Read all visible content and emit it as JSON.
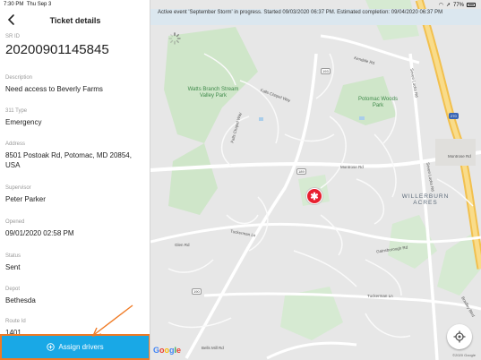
{
  "status_bar": {
    "time": "7:30 PM",
    "day": "Thu Sep 3",
    "battery": "77%"
  },
  "panel": {
    "title": "Ticket details",
    "fields": [
      {
        "label": "SR ID",
        "value": "20200901145845"
      },
      {
        "label": "Description",
        "value": "Need access to Beverly Farms"
      },
      {
        "label": "311 Type",
        "value": "Emergency"
      },
      {
        "label": "Address",
        "value": "8501 Postoak Rd, Potomac, MD 20854, USA"
      },
      {
        "label": "Supervisor",
        "value": "Peter  Parker"
      },
      {
        "label": "Opened",
        "value": "09/01/2020 02:58 PM"
      },
      {
        "label": "Status",
        "value": "Sent"
      },
      {
        "label": "Depot",
        "value": "Bethesda"
      },
      {
        "label": "Route Id",
        "value": "1401"
      }
    ],
    "assign_button": "Assign drivers"
  },
  "banner": "Active event 'September Storm' in progress. Started 09/03/2020 06:37 PM. Estimated completion: 09/04/2020 06:37 PM",
  "map": {
    "parks": [
      "Watts Branch Stream Valley Park",
      "Potomac Woods Park"
    ],
    "area_label": "WILLERBURN ACRES",
    "roads": [
      "Falls Chapel Way",
      "Falls Chapel Way",
      "Montrose Rd",
      "Montrose Rd",
      "Seven Locks Rd",
      "Seven Locks Rd",
      "Tuckerman Ln",
      "Tuckerman Ln",
      "Gainsborough Rd",
      "Glen Rd",
      "Bells Mill Rd",
      "Kendale Rd",
      "Bradley Blvd"
    ],
    "route_shields": [
      "193",
      "189",
      "190",
      "270"
    ],
    "google": "Google",
    "copyright": "©2020 Google"
  },
  "colors": {
    "accent": "#19a8e6",
    "highlight": "#f07a24",
    "marker": "#e8202f",
    "park": "#c8e3c4",
    "highway": "#f7c95c"
  }
}
